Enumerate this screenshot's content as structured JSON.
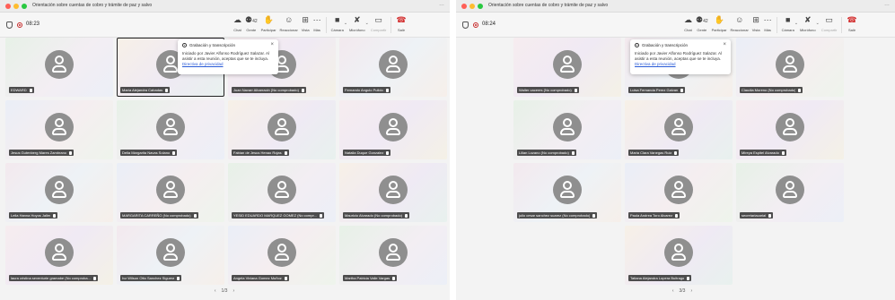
{
  "window": {
    "title": "Orientación sobre cuentas de cobro y trámite de paz y salvo",
    "more_icon": "ellipsis-icon"
  },
  "toolbar": {
    "items": [
      {
        "label": "Chat",
        "icon": "chat-icon"
      },
      {
        "label": "Gente",
        "icon": "people-icon",
        "count": "42"
      },
      {
        "label": "Participar",
        "icon": "raise-hand-icon"
      },
      {
        "label": "Reaccionar",
        "icon": "reaction-icon"
      },
      {
        "label": "Vista",
        "icon": "layout-icon"
      },
      {
        "label": "Más",
        "icon": "more-icon"
      }
    ],
    "media": [
      {
        "label": "Cámara",
        "icon": "camera-off-icon"
      },
      {
        "label": "Micrófono",
        "icon": "mic-off-icon"
      },
      {
        "label": "Compartir",
        "icon": "share-icon"
      }
    ],
    "exit_label": "Salir"
  },
  "left": {
    "clock": "08:23",
    "tiles": [
      {
        "name": "EDWARD"
      },
      {
        "name": "María Alejandra Cabadas",
        "speaking": true
      },
      {
        "name": "Juan Navarr Albarracin (No comprobado)"
      },
      {
        "name": "Fernando Angulo Pulido"
      },
      {
        "name": "Jesus Gutenberg Mares Zambrano"
      },
      {
        "name": "Delia Margarita Navas Solano"
      },
      {
        "name": "Fabian de Jesus Henao Rojas"
      },
      {
        "name": "Natalia Duque Gonzalez"
      },
      {
        "name": "Leila Hanna Hoyos Jaller"
      },
      {
        "name": "MARGARITA CARREÑO (No comprobado)"
      },
      {
        "name": "YESID EDUARDO MARQUEZ GOMEZ (No compr..."
      },
      {
        "name": "Mauricio Alvarado (No comprobado)"
      },
      {
        "name": "laura cristina seventurie gramabe (No comproba..."
      },
      {
        "name": "Ivz Wilson Otto Sanchez Siguera"
      },
      {
        "name": "Angela Viviana Gomez Muñoz"
      },
      {
        "name": "Martha Patricia Valle Vargas"
      }
    ],
    "pager": {
      "prev": "‹",
      "page": "1/3",
      "next": "›"
    }
  },
  "right": {
    "clock": "08:24",
    "tiles": [
      {
        "name": "Walter caceres (No comprobado)"
      },
      {
        "name": "Luisa Fernanda Perez Galvan"
      },
      {
        "name": "Claudia Moreno (No comprobado)"
      },
      {
        "name": "Lilian Lozano (No comprobado)"
      },
      {
        "name": "Maria Clara Vanegas Ruiz"
      },
      {
        "name": "Mireya Espitel Alvarado"
      },
      {
        "name": "julio cesar sanchez suarez (No comprobado)"
      },
      {
        "name": "Paula Andrea Toro Alvarez"
      },
      {
        "name": "secretariacarial"
      },
      {
        "name": "Tatiana Alejandra Lopera Buitrago"
      }
    ],
    "pager": {
      "prev": "‹",
      "page": "3/3",
      "next": "›"
    }
  },
  "popup": {
    "title": "Grabación y transcripción",
    "close": "×",
    "body": "Iniciado por Javier Alfonso Rodríguez Salazar. Al asistir a esta reunión, aceptas que se te incluya.",
    "link": "Directiva de privacidad"
  }
}
